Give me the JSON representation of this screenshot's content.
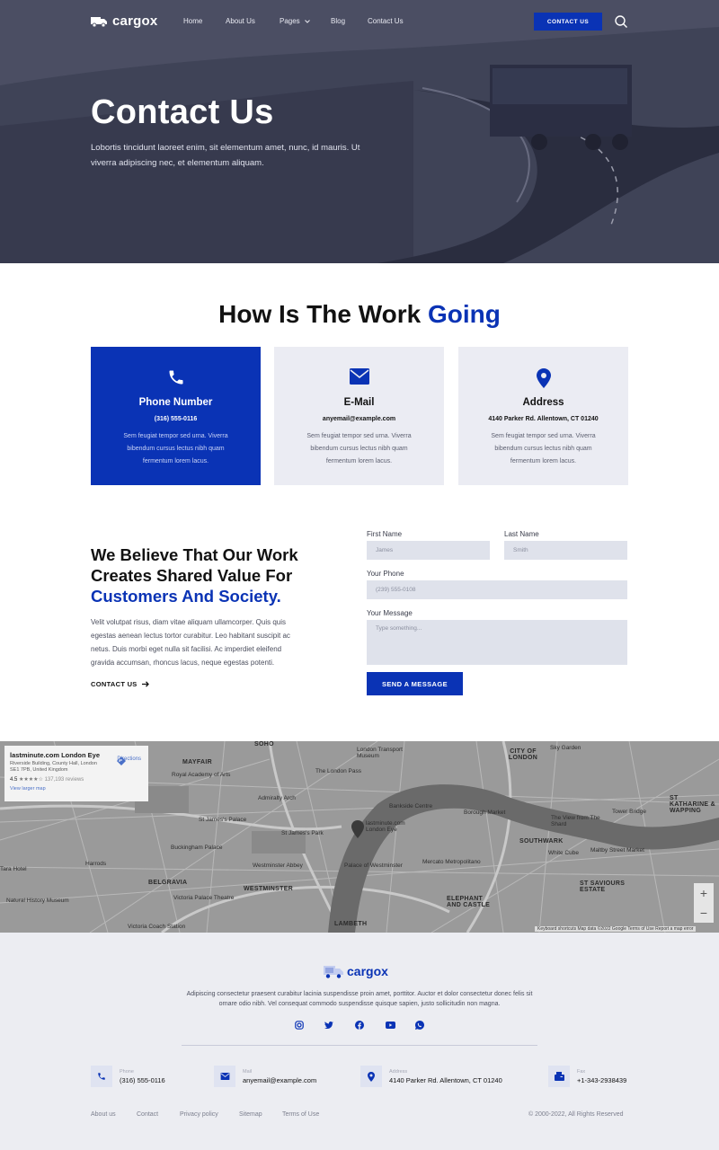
{
  "nav": {
    "logo": "cargox",
    "links": [
      "Home",
      "About Us",
      "Pages",
      "Blog",
      "Contact Us"
    ],
    "cta": "CONTACT US"
  },
  "hero": {
    "title": "Contact Us",
    "subtitle": "Lobortis tincidunt laoreet enim, sit elementum amet, nunc, id mauris. Ut viverra adipiscing nec, et elementum aliquam."
  },
  "section": {
    "title_main": "How Is The Work ",
    "title_accent": "Going"
  },
  "cards": [
    {
      "icon": "phone-icon",
      "title": "Phone Number",
      "value": "(316) 555-0116",
      "desc": "Sem feugiat tempor sed urna. Viverra bibendum cursus lectus nibh quam fermentum lorem lacus."
    },
    {
      "icon": "mail-icon",
      "title": "E-Mail",
      "value": "anyemail@example.com",
      "desc": "Sem feugiat tempor sed urna. Viverra bibendum cursus lectus nibh quam fermentum lorem lacus."
    },
    {
      "icon": "location-pin-icon",
      "title": "Address",
      "value": "4140 Parker Rd. Allentown, CT 01240",
      "desc": "Sem feugiat tempor sed urna. Viverra bibendum cursus lectus nibh quam fermentum lorem lacus."
    }
  ],
  "believe": {
    "title_main": "We Believe That Our Work Creates Shared Value For ",
    "title_accent": "Customers And Society.",
    "text": "Velit volutpat risus, diam vitae aliquam ullamcorper. Quis quis egestas aenean lectus tortor curabitur. Leo habitant suscipit ac netus. Duis morbi eget nulla sit facilisi. Ac imperdiet eleifend gravida accumsan, rhoncus lacus, neque egestas potenti.",
    "link": "CONTACT US"
  },
  "form": {
    "first_name_label": "First Name",
    "first_name_placeholder": "James",
    "last_name_label": "Last Name",
    "last_name_placeholder": "Smith",
    "phone_label": "Your Phone",
    "phone_placeholder": "(239) 555-0108",
    "message_label": "Your Message",
    "message_placeholder": "Type something...",
    "submit": "SEND A MESSAGE"
  },
  "map": {
    "place_title": "lastminute.com London Eye",
    "place_address": "Riverside Building, County Hall, London SE1 7PB, United Kingdom",
    "rating": "4.5",
    "reviews": "137,193 reviews",
    "larger_map": "View larger map",
    "directions": "Directions",
    "labels": [
      "SOHO",
      "MAYFAIR",
      "CITY OF LONDON",
      "London Transport Museum",
      "Sky Garden",
      "Royal Academy of Arts",
      "The London Pass",
      "Admiralty Arch",
      "Bankside Centre",
      "Borough Market",
      "St James's Palace",
      "St James's Park",
      "lastminute.com London Eye",
      "The View from The Shard",
      "Buckingham Palace",
      "SOUTHWARK",
      "BELGRAVIA",
      "Westminster Abbey",
      "Palace of Westminster",
      "Mercato Metropolitano",
      "WESTMINSTER",
      "ELEPHANT AND CASTLE",
      "Natural History Museum",
      "Victoria Coach Station",
      "LAMBETH",
      "Tower Bridge",
      "ST KATHARINE & WAPPING",
      "Harrods",
      "Tara Hotel",
      "ST SAVIOURS ESTATE",
      "Maltby Street Market",
      "White Cube",
      "Victoria Palace Theatre"
    ],
    "footer": "Keyboard shortcuts   Map data ©2022 Google   Terms of Use   Report a map error"
  },
  "footer": {
    "logo": "cargox",
    "desc": "Adipiscing consectetur praesent curabitur lacinia suspendisse proin amet, porttitor. Auctor et dolor consectetur donec felis sit ornare odio nibh. Vel consequat commodo suspendisse quisque sapien, justo sollicitudin non magna.",
    "social": [
      "instagram-icon",
      "twitter-icon",
      "facebook-icon",
      "youtube-icon",
      "whatsapp-icon"
    ],
    "contacts": [
      {
        "label": "Phone",
        "value": "(316) 555-0116"
      },
      {
        "label": "Mail",
        "value": "anyemail@example.com"
      },
      {
        "label": "Address",
        "value": "4140 Parker Rd. Allentown, CT 01240"
      },
      {
        "label": "Fax",
        "value": "+1-343-2938439"
      }
    ],
    "links": [
      "About us",
      "Contact",
      "Privacy policy",
      "Sitemap",
      "Terms of Use"
    ],
    "copyright": "© 2000-2022, All Rights Reserved"
  },
  "colors": {
    "accent": "#0a33b5",
    "card_bg": "#ebecf3",
    "footer_bg": "#ecedf2"
  }
}
